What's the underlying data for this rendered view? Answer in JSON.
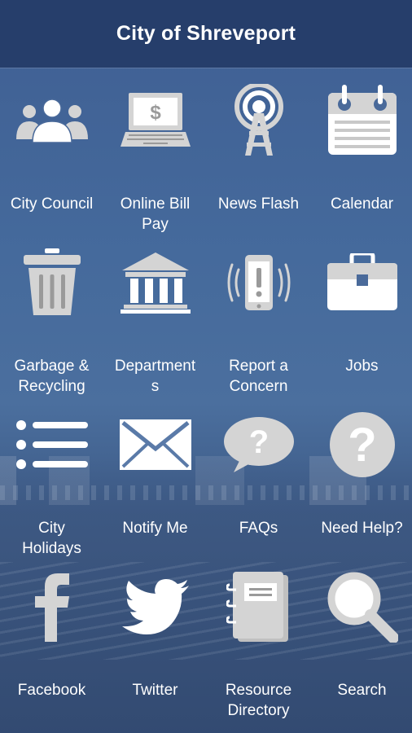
{
  "header": {
    "title": "City of Shreveport"
  },
  "tiles": [
    {
      "lines": [
        "City Council"
      ]
    },
    {
      "lines": [
        "Online Bill",
        "Pay"
      ]
    },
    {
      "lines": [
        "News Flash"
      ]
    },
    {
      "lines": [
        "Calendar"
      ]
    },
    {
      "lines": [
        "Garbage &",
        "Recycling"
      ]
    },
    {
      "lines": [
        "Department",
        "s"
      ]
    },
    {
      "lines": [
        "Report a",
        "Concern"
      ]
    },
    {
      "lines": [
        "Jobs"
      ]
    },
    {
      "lines": [
        "City",
        "Holidays"
      ]
    },
    {
      "lines": [
        "Notify Me"
      ]
    },
    {
      "lines": [
        "FAQs"
      ]
    },
    {
      "lines": [
        "Need Help?"
      ]
    },
    {
      "lines": [
        "Facebook"
      ]
    },
    {
      "lines": [
        "Twitter"
      ]
    },
    {
      "lines": [
        "Resource",
        "Directory"
      ]
    },
    {
      "lines": [
        "Search"
      ]
    }
  ],
  "colors": {
    "header_bg": "#263e6b",
    "icon_fill": "#d4d4d4",
    "text": "#ffffff"
  }
}
